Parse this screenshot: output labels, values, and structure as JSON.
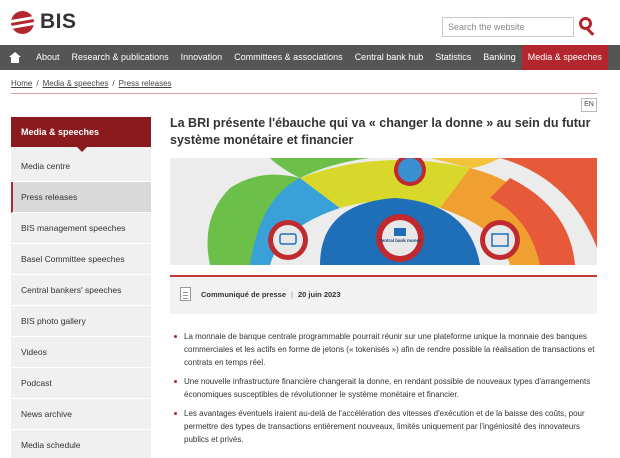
{
  "header": {
    "logo_text": "BIS",
    "search_placeholder": "Search the website"
  },
  "nav": {
    "items": [
      {
        "label": "About"
      },
      {
        "label": "Research & publications"
      },
      {
        "label": "Innovation"
      },
      {
        "label": "Committees & associations"
      },
      {
        "label": "Central bank hub"
      },
      {
        "label": "Statistics"
      },
      {
        "label": "Banking"
      },
      {
        "label": "Media & speeches"
      }
    ]
  },
  "breadcrumb": {
    "home": "Home",
    "media": "Media & speeches",
    "press": "Press releases"
  },
  "language": "EN",
  "sidebar": {
    "heading": "Media & speeches",
    "items": [
      {
        "label": "Media centre"
      },
      {
        "label": "Press releases"
      },
      {
        "label": "BIS management speeches"
      },
      {
        "label": "Basel Committee speeches"
      },
      {
        "label": "Central bankers' speeches"
      },
      {
        "label": "BIS photo gallery"
      },
      {
        "label": "Videos"
      },
      {
        "label": "Podcast"
      },
      {
        "label": "News archive"
      },
      {
        "label": "Media schedule"
      }
    ]
  },
  "article": {
    "title": "La BRI présente l'ébauche qui va « changer la donne » au sein du futur système monétaire et financier",
    "hero_label": "Central bank money",
    "meta_type": "Communiqué de presse",
    "meta_date": "20 juin 2023",
    "bullets": [
      "La monnaie de banque centrale programmable pourrait réunir sur une plateforme unique la monnaie des banques commerciales et les actifs en forme de jetons (« tokenisés ») afin de rendre possible la réalisation de transactions et contrats en temps réel.",
      "Une nouvelle infrastructure financière changerait la donne, en rendant possible de nouveaux types d'arrangements économiques susceptibles de révolutionner le système monétaire et financier.",
      "Les avantages éventuels iraient au-delà de l'accélération des vitesses d'exécution et de la baisse des coûts, pour permettre des types de transactions entièrement nouveaux, limités uniquement par l'ingéniosité des innovateurs publics et privés."
    ]
  },
  "colors": {
    "brand_red": "#b3262d",
    "nav_bg": "#555555",
    "sidebar_head": "#8b1a1f"
  }
}
